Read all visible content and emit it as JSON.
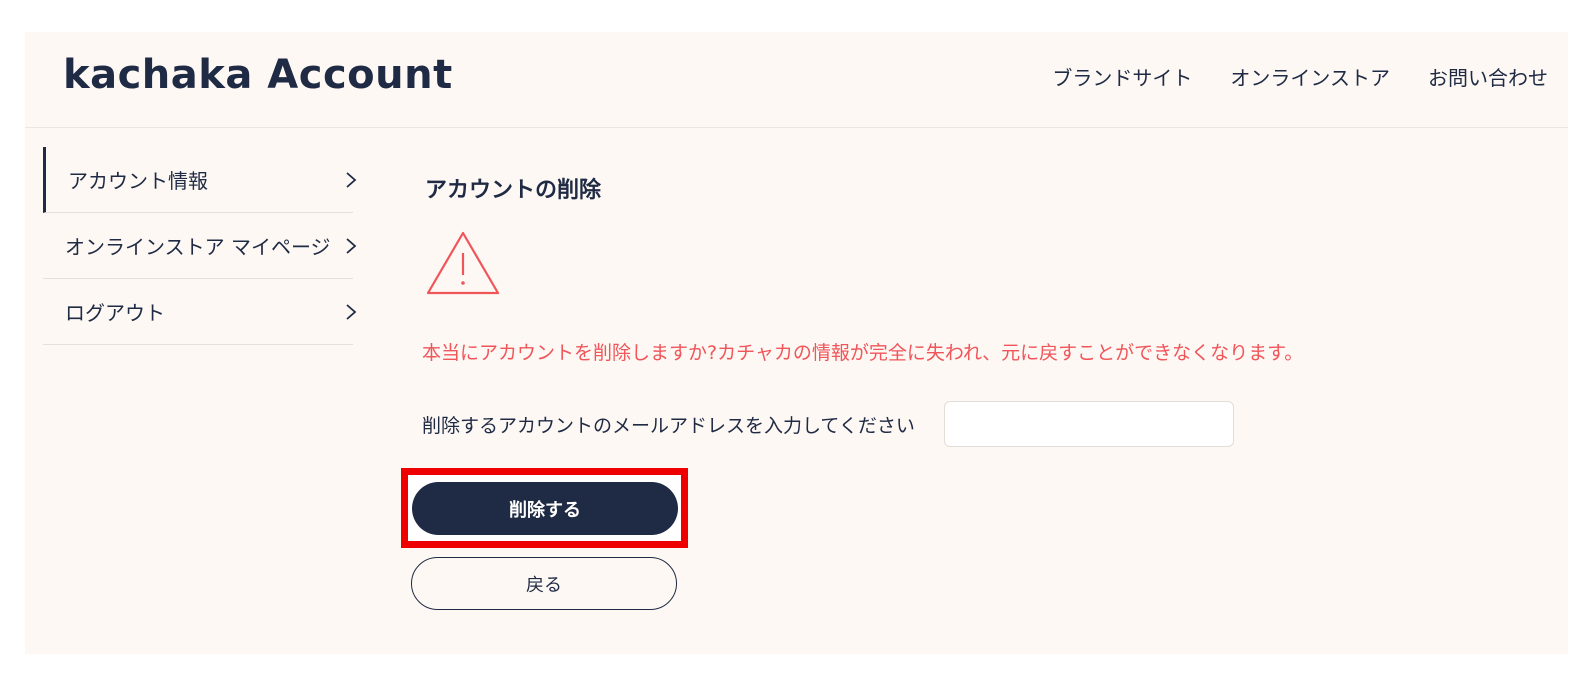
{
  "header": {
    "logo": "kachaka Account",
    "nav": [
      "ブランドサイト",
      "オンラインストア",
      "お問い合わせ"
    ]
  },
  "sidebar": {
    "items": [
      {
        "label": "アカウント情報",
        "active": true
      },
      {
        "label": "オンラインストア マイページ",
        "active": false
      },
      {
        "label": "ログアウト",
        "active": false
      }
    ]
  },
  "main": {
    "title": "アカウントの削除",
    "warning_icon": "warning-triangle-icon",
    "warning_text": "本当にアカウントを削除しますか?カチャカの情報が完全に失われ、元に戻すことができなくなります。",
    "email_label": "削除するアカウントのメールアドレスを入力してください",
    "email_value": "",
    "delete_button": "削除する",
    "back_button": "戻る"
  },
  "colors": {
    "background": "#fdf8f3",
    "primary": "#1f2a44",
    "warning": "#f0555a",
    "highlight": "#ee0000"
  }
}
